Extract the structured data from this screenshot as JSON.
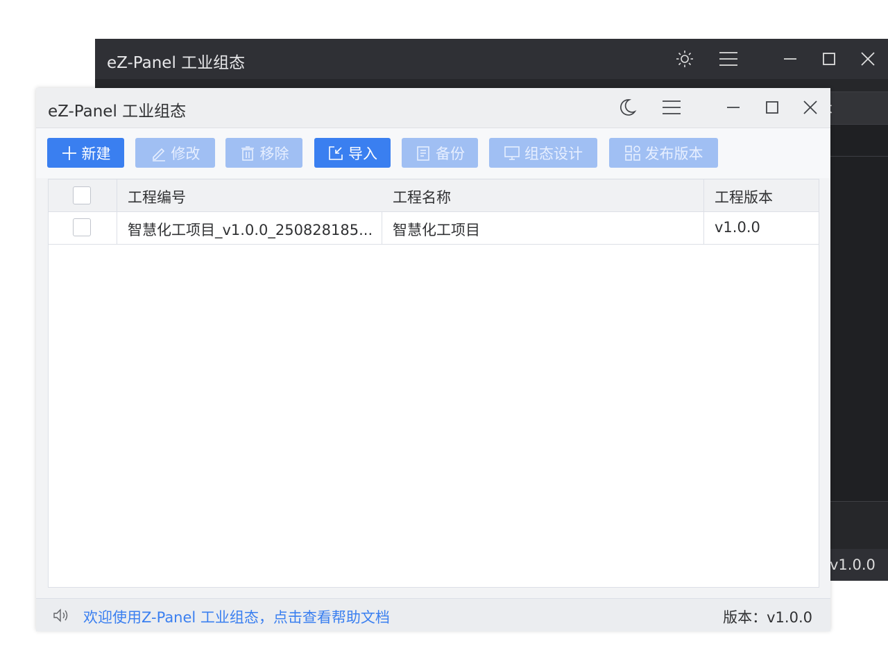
{
  "dark_window": {
    "title": "eZ-Panel 工业组态",
    "header_fragment": "本",
    "status_version": "v1.0.0",
    "icons": [
      "sun-icon",
      "menu-icon",
      "minimize-icon",
      "maximize-icon",
      "close-icon"
    ]
  },
  "window": {
    "title": "eZ-Panel 工业组态",
    "icons": [
      "moon-icon",
      "menu-icon",
      "minimize-icon",
      "maximize-icon",
      "close-icon"
    ]
  },
  "toolbar": {
    "new_label": "新建",
    "edit_label": "修改",
    "remove_label": "移除",
    "import_label": "导入",
    "backup_label": "备份",
    "design_label": "组态设计",
    "publish_label": "发布版本"
  },
  "table": {
    "columns": [
      "工程编号",
      "工程名称",
      "工程版本"
    ],
    "rows": [
      {
        "id": "智慧化工项目_v1.0.0_250828185...",
        "name": "智慧化工项目",
        "version": "v1.0.0"
      }
    ]
  },
  "statusbar": {
    "welcome": "欢迎使用Z-Panel 工业组态，点击查看帮助文档",
    "version": "版本：v1.0.0"
  },
  "colors": {
    "primary": "#3a7ff0",
    "primary_disabled": "#a0bff3",
    "dark_bg": "#2a2b2e"
  }
}
